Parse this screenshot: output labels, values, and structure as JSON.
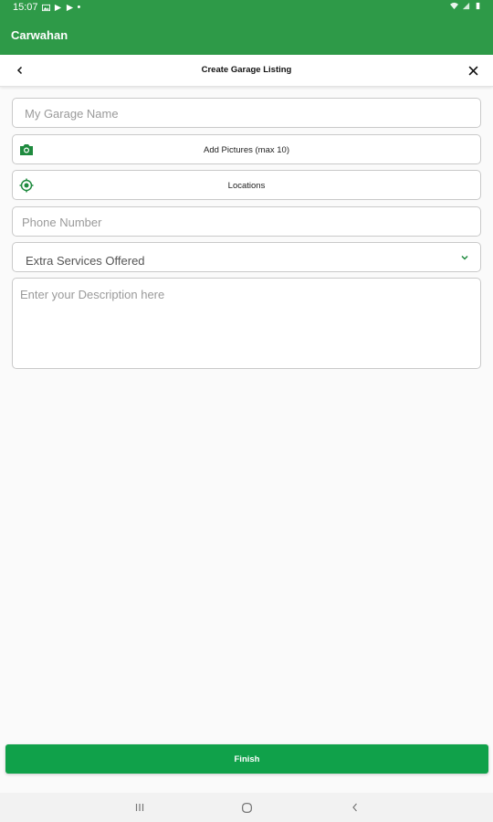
{
  "status_bar": {
    "time": "15:07",
    "dot": "•"
  },
  "app_bar": {
    "title": "Carwahan"
  },
  "header": {
    "title": "Create Garage Listing"
  },
  "form": {
    "garage_name_placeholder": "My Garage Name",
    "add_pictures_label": "Add Pictures (max 10)",
    "locations_label": "Locations",
    "phone_placeholder": "Phone Number",
    "extra_services_label": "Extra Services Offered",
    "description_placeholder": "Enter your Description here"
  },
  "finish_label": "Finish",
  "colors": {
    "primary": "#2e9a48",
    "button": "#10a14a",
    "accent_icon": "#1e8a3e"
  },
  "icons": [
    "back-arrow-icon",
    "close-icon",
    "camera-icon",
    "location-target-icon",
    "chevron-down-icon",
    "recents-icon",
    "home-icon",
    "nav-back-icon"
  ]
}
